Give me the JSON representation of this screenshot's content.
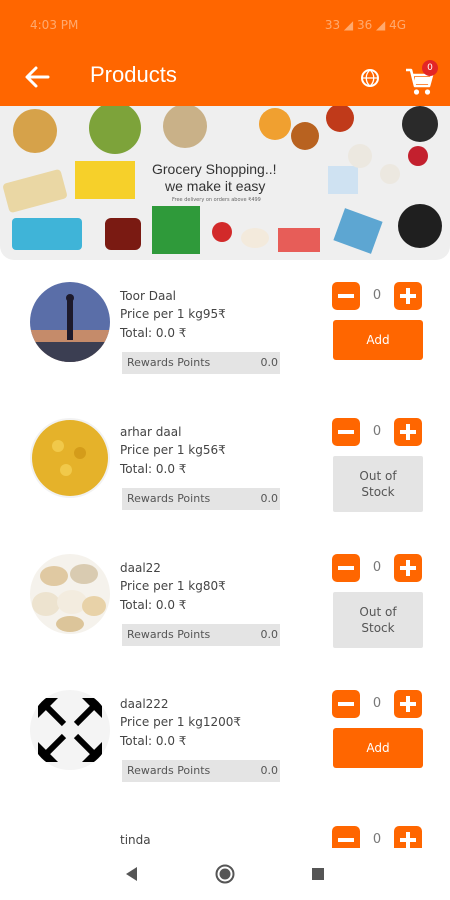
{
  "status": {
    "time": "4:03 PM",
    "right": "33 ◢ 36 ◢ 4G"
  },
  "app_bar": {
    "title": "Products",
    "cart_count": "0"
  },
  "banner": {
    "headline_1": "Grocery Shopping..!",
    "headline_2": "we make it easy",
    "subline": "Free delivery on orders above ₹499"
  },
  "products": [
    {
      "name": "Toor Daal",
      "price": "Price per 1 kg95₹",
      "total": "Total: 0.0 ₹",
      "rewards_label": "Rewards Points",
      "rewards_value": "0.0",
      "qty": "0",
      "action": "Add",
      "in_stock": true
    },
    {
      "name": "arhar daal",
      "price": "Price per 1 kg56₹",
      "total": "Total: 0.0 ₹",
      "rewards_label": "Rewards Points",
      "rewards_value": "0.0",
      "qty": "0",
      "action": "Out of Stock",
      "in_stock": false
    },
    {
      "name": "daal22",
      "price": "Price per 1 kg80₹",
      "total": "Total: 0.0 ₹",
      "rewards_label": "Rewards Points",
      "rewards_value": "0.0",
      "qty": "0",
      "action": "Out of Stock",
      "in_stock": false
    },
    {
      "name": "daal222",
      "price": "Price per 1 kg1200₹",
      "total": "Total: 0.0 ₹",
      "rewards_label": "Rewards Points",
      "rewards_value": "0.0",
      "qty": "0",
      "action": "Add",
      "in_stock": true
    },
    {
      "name": "tinda",
      "qty": "0"
    }
  ],
  "icons": {
    "back": "arrow-left-icon",
    "globe": "globe-icon",
    "cart": "cart-icon"
  },
  "colors": {
    "primary": "#ff6600",
    "badge": "#e32626",
    "disabled_bg": "#e4e4e4"
  }
}
